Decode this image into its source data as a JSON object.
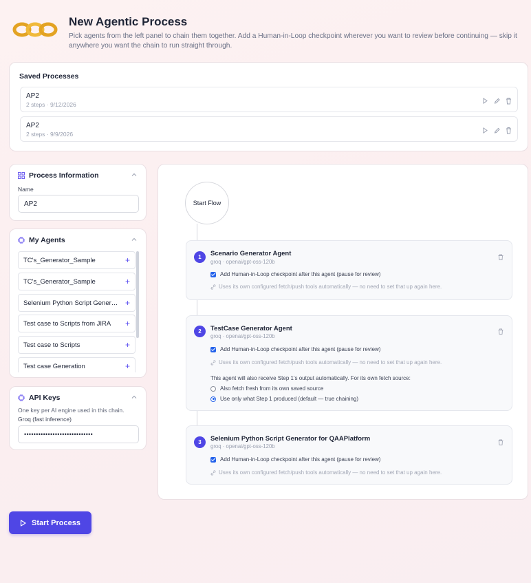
{
  "header": {
    "title": "New Agentic Process",
    "subtitle": "Pick agents from the left panel to chain them together. Add a Human-in-Loop checkpoint wherever you want to review before continuing — skip it anywhere you want the chain to run straight through."
  },
  "saved": {
    "title": "Saved Processes",
    "items": [
      {
        "name": "AP2",
        "meta": "2 steps · 9/12/2026"
      },
      {
        "name": "AP2",
        "meta": "2 steps · 9/9/2026"
      }
    ]
  },
  "process_info": {
    "title": "Process Information",
    "name_label": "Name",
    "name_value": "AP2"
  },
  "my_agents": {
    "title": "My Agents",
    "items": [
      "TC's_Generator_Sample",
      "TC's_Generator_Sample",
      "Selenium Python Script Generator for QAAPlatform",
      "Test case to Scripts from JIRA",
      "Test case to Scripts",
      "Test case Generation"
    ]
  },
  "api_keys": {
    "title": "API Keys",
    "hint": "One key per AI engine used in this chain.",
    "groq_label": "Groq (fast inference)",
    "groq_value": "•••••••••••••••••••••••••••••"
  },
  "flow": {
    "start_label": "Start Flow",
    "steps": [
      {
        "num": "1",
        "title": "Scenario Generator Agent",
        "meta": "groq · openai/gpt-oss-120b",
        "hil_label": "Add Human-in-Loop checkpoint after this agent (pause for review)",
        "note": "Uses its own configured fetch/push tools automatically — no need to set that up again here."
      },
      {
        "num": "2",
        "title": "TestCase Generator Agent",
        "meta": "groq · openai/gpt-oss-120b",
        "hil_label": "Add Human-in-Loop checkpoint after this agent (pause for review)",
        "note": "Uses its own configured fetch/push tools automatically — no need to set that up again here.",
        "receive_text": "This agent will also receive Step 1's output automatically. For its own fetch source:",
        "option_fetch": "Also fetch fresh from its own saved source",
        "option_only": "Use only what Step 1 produced (default — true chaining)",
        "selected_option": "option_only"
      },
      {
        "num": "3",
        "title": "Selenium Python Script Generator for QAAPlatform",
        "meta": "groq · openai/gpt-oss-120b",
        "hil_label": "Add Human-in-Loop checkpoint after this agent (pause for review)",
        "note": "Uses its own configured fetch/push tools automatically — no need to set that up again here."
      }
    ]
  },
  "actions": {
    "start_label": "Start Process"
  },
  "colors": {
    "accent": "#4f46e5",
    "checkbox": "#2563eb",
    "background": "#fbeff1"
  }
}
